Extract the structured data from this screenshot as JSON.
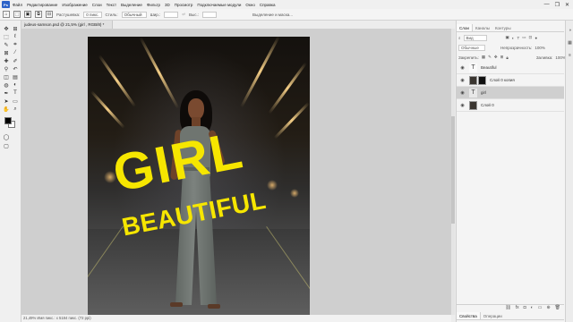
{
  "app": {
    "logo": "Ps"
  },
  "menu": [
    "Файл",
    "Редактирование",
    "Изображение",
    "Слои",
    "Текст",
    "Выделение",
    "Фильтр",
    "3D",
    "Просмотр",
    "Подключаемые модули",
    "Окно",
    "Справка"
  ],
  "window_buttons": [
    "—",
    "❐",
    "✕"
  ],
  "options_bar": {
    "feather_label": "Растушевка:",
    "feather_value": "0 пикс.",
    "style_label": "Стиль:",
    "style_value": "Обычный",
    "width_label": "Шир.:",
    "height_label": "Выс.:",
    "select_mask": "Выделение и маска..."
  },
  "document": {
    "tab_title": "judeus-samson.psd @ 21,5% (girl , RGB/8) *",
    "status": "21,49%     Имя пикс.: x 5184 пикс. (72 ppi)",
    "text_girl": "GIRL",
    "text_beautiful": "BEAUTIFUL"
  },
  "panels": {
    "tabs": [
      "Слои",
      "Каналы",
      "Контуры"
    ],
    "kind_label": "Вид",
    "blend_mode": "Обычные",
    "opacity_label": "Непрозрачность:",
    "opacity_value": "100%",
    "lock_label": "Закрепить:",
    "fill_label": "Заливка:",
    "fill_value": "100%",
    "layers": [
      {
        "name": "Beautiful",
        "type": "text",
        "selected": false
      },
      {
        "name": "Слой 0 копия",
        "type": "image-mask",
        "selected": false
      },
      {
        "name": "girl",
        "type": "text",
        "selected": true
      },
      {
        "name": "Слой 0",
        "type": "image",
        "selected": false
      }
    ],
    "bottom_tabs": [
      "Свойства",
      "Операции"
    ]
  },
  "colors": {
    "text_yellow": "#f6e600",
    "selected_layer": "#cfcfcf"
  }
}
